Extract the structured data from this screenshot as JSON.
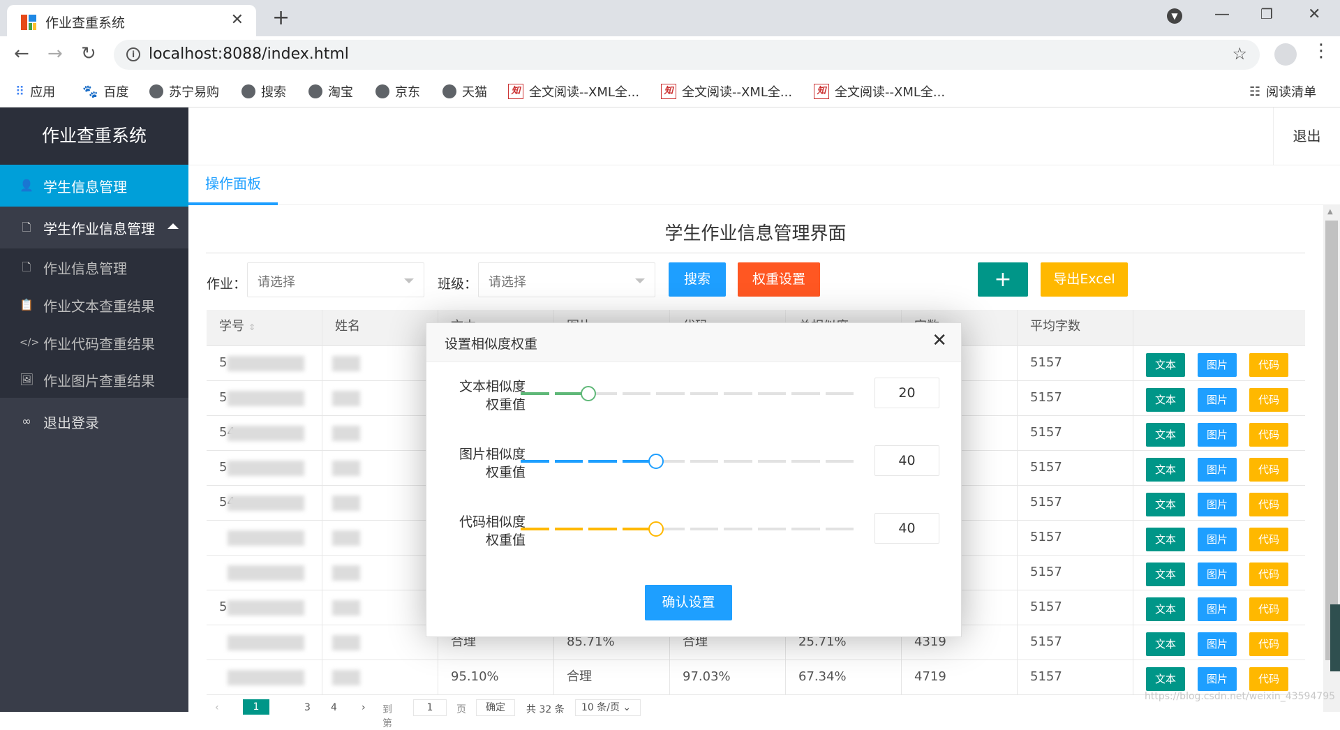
{
  "browser": {
    "tab_title": "作业查重系统",
    "url": "localhost:8088/index.html",
    "bookmarks": [
      "应用",
      "百度",
      "苏宁易购",
      "搜索",
      "淘宝",
      "京东",
      "天猫",
      "全文阅读--XML全...",
      "全文阅读--XML全...",
      "全文阅读--XML全..."
    ],
    "reading_list": "阅读清单"
  },
  "app": {
    "brand": "作业查重系统",
    "logout": "退出",
    "sidebar": {
      "items": [
        {
          "label": "学生信息管理",
          "icon": "user-icon"
        },
        {
          "label": "学生作业信息管理",
          "icon": "file-icon"
        },
        {
          "label": "作业信息管理",
          "icon": "file-icon"
        },
        {
          "label": "作业文本查重结果",
          "icon": "clipboard-icon"
        },
        {
          "label": "作业代码查重结果",
          "icon": "code-icon"
        },
        {
          "label": "作业图片查重结果",
          "icon": "image-icon"
        },
        {
          "label": "退出登录",
          "icon": "link-icon"
        }
      ]
    },
    "tab": "操作面板",
    "title": "学生作业信息管理界面",
    "filters": {
      "homework_label": "作业：",
      "homework_placeholder": "请选择",
      "class_label": "班级：",
      "class_placeholder": "请选择"
    },
    "buttons": {
      "search": "搜索",
      "weight": "权重设置",
      "add": "+",
      "export": "导出Excel"
    },
    "colors": {
      "green": "#009688",
      "blue": "#1e9fff",
      "orange": "#ff5722",
      "yellow": "#ffb800",
      "sidebar": "#393d49"
    }
  },
  "table": {
    "headers": [
      "学号",
      "姓名",
      "文本",
      "图片",
      "代码",
      "总相似度",
      "字数",
      "平均字数",
      ""
    ],
    "rows": [
      {
        "id": "5",
        "text": "",
        "image": "",
        "code": "",
        "total": "",
        "words": "",
        "avg": "5157"
      },
      {
        "id": "5",
        "text": "",
        "image": "",
        "code": "",
        "total": "",
        "words": "",
        "avg": "5157"
      },
      {
        "id": "54",
        "text": "",
        "image": "",
        "code": "",
        "total": "",
        "words": "",
        "avg": "5157"
      },
      {
        "id": "5",
        "text": "",
        "image": "",
        "code": "",
        "total": "",
        "words": "",
        "avg": "5157"
      },
      {
        "id": "54",
        "text": "",
        "image": "",
        "code": "",
        "total": "",
        "words": "",
        "avg": "5157"
      },
      {
        "id": "",
        "text": "",
        "image": "",
        "code": "",
        "total": "",
        "words": "",
        "avg": "5157"
      },
      {
        "id": "",
        "text": "",
        "image": "",
        "code": "",
        "total": "",
        "words": "",
        "avg": "5157"
      },
      {
        "id": "5",
        "text": "",
        "image": "",
        "code": "",
        "total": "",
        "words": "",
        "avg": "5157"
      },
      {
        "id": "",
        "text": "合理",
        "image": "85.71%",
        "code": "合理",
        "total": "25.71%",
        "words": "4319",
        "avg": "5157"
      },
      {
        "id": "",
        "text": "95.10%",
        "image": "合理",
        "code": "97.03%",
        "total": "67.34%",
        "words": "4719",
        "avg": "5157"
      }
    ],
    "row_buttons": {
      "text": "文本",
      "image": "图片",
      "code": "代码"
    }
  },
  "pager": {
    "current": "1",
    "pages": [
      "3",
      "4"
    ],
    "goto_label": "到第",
    "goto_value": "1",
    "page_unit": "页",
    "confirm": "确定",
    "total": "共 32 条",
    "per_page": "10 条/页"
  },
  "dialog": {
    "title": "设置相似度权重",
    "sliders": [
      {
        "label1": "文本相似度",
        "label2": "权重值",
        "value": "20",
        "fraction": 0.2,
        "color": "#5fb878"
      },
      {
        "label1": "图片相似度",
        "label2": "权重值",
        "value": "40",
        "fraction": 0.4,
        "color": "#1e9fff"
      },
      {
        "label1": "代码相似度",
        "label2": "权重值",
        "value": "40",
        "fraction": 0.4,
        "color": "#ffb800"
      }
    ],
    "confirm": "确认设置"
  },
  "watermark": "https://blog.csdn.net/weixin_43594795"
}
